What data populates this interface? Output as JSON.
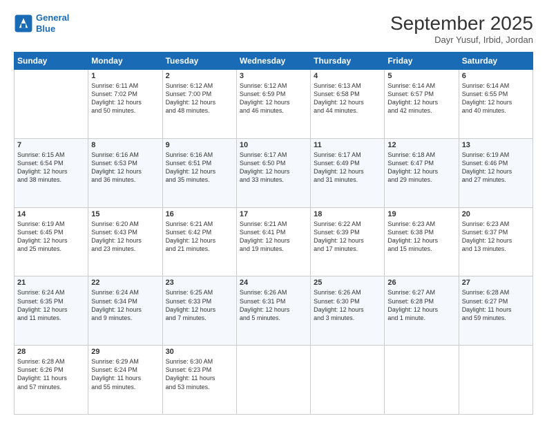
{
  "header": {
    "logo_line1": "General",
    "logo_line2": "Blue",
    "month": "September 2025",
    "location": "Dayr Yusuf, Irbid, Jordan"
  },
  "weekdays": [
    "Sunday",
    "Monday",
    "Tuesday",
    "Wednesday",
    "Thursday",
    "Friday",
    "Saturday"
  ],
  "weeks": [
    [
      {
        "day": "",
        "text": ""
      },
      {
        "day": "1",
        "text": "Sunrise: 6:11 AM\nSunset: 7:02 PM\nDaylight: 12 hours\nand 50 minutes."
      },
      {
        "day": "2",
        "text": "Sunrise: 6:12 AM\nSunset: 7:00 PM\nDaylight: 12 hours\nand 48 minutes."
      },
      {
        "day": "3",
        "text": "Sunrise: 6:12 AM\nSunset: 6:59 PM\nDaylight: 12 hours\nand 46 minutes."
      },
      {
        "day": "4",
        "text": "Sunrise: 6:13 AM\nSunset: 6:58 PM\nDaylight: 12 hours\nand 44 minutes."
      },
      {
        "day": "5",
        "text": "Sunrise: 6:14 AM\nSunset: 6:57 PM\nDaylight: 12 hours\nand 42 minutes."
      },
      {
        "day": "6",
        "text": "Sunrise: 6:14 AM\nSunset: 6:55 PM\nDaylight: 12 hours\nand 40 minutes."
      }
    ],
    [
      {
        "day": "7",
        "text": "Sunrise: 6:15 AM\nSunset: 6:54 PM\nDaylight: 12 hours\nand 38 minutes."
      },
      {
        "day": "8",
        "text": "Sunrise: 6:16 AM\nSunset: 6:53 PM\nDaylight: 12 hours\nand 36 minutes."
      },
      {
        "day": "9",
        "text": "Sunrise: 6:16 AM\nSunset: 6:51 PM\nDaylight: 12 hours\nand 35 minutes."
      },
      {
        "day": "10",
        "text": "Sunrise: 6:17 AM\nSunset: 6:50 PM\nDaylight: 12 hours\nand 33 minutes."
      },
      {
        "day": "11",
        "text": "Sunrise: 6:17 AM\nSunset: 6:49 PM\nDaylight: 12 hours\nand 31 minutes."
      },
      {
        "day": "12",
        "text": "Sunrise: 6:18 AM\nSunset: 6:47 PM\nDaylight: 12 hours\nand 29 minutes."
      },
      {
        "day": "13",
        "text": "Sunrise: 6:19 AM\nSunset: 6:46 PM\nDaylight: 12 hours\nand 27 minutes."
      }
    ],
    [
      {
        "day": "14",
        "text": "Sunrise: 6:19 AM\nSunset: 6:45 PM\nDaylight: 12 hours\nand 25 minutes."
      },
      {
        "day": "15",
        "text": "Sunrise: 6:20 AM\nSunset: 6:43 PM\nDaylight: 12 hours\nand 23 minutes."
      },
      {
        "day": "16",
        "text": "Sunrise: 6:21 AM\nSunset: 6:42 PM\nDaylight: 12 hours\nand 21 minutes."
      },
      {
        "day": "17",
        "text": "Sunrise: 6:21 AM\nSunset: 6:41 PM\nDaylight: 12 hours\nand 19 minutes."
      },
      {
        "day": "18",
        "text": "Sunrise: 6:22 AM\nSunset: 6:39 PM\nDaylight: 12 hours\nand 17 minutes."
      },
      {
        "day": "19",
        "text": "Sunrise: 6:23 AM\nSunset: 6:38 PM\nDaylight: 12 hours\nand 15 minutes."
      },
      {
        "day": "20",
        "text": "Sunrise: 6:23 AM\nSunset: 6:37 PM\nDaylight: 12 hours\nand 13 minutes."
      }
    ],
    [
      {
        "day": "21",
        "text": "Sunrise: 6:24 AM\nSunset: 6:35 PM\nDaylight: 12 hours\nand 11 minutes."
      },
      {
        "day": "22",
        "text": "Sunrise: 6:24 AM\nSunset: 6:34 PM\nDaylight: 12 hours\nand 9 minutes."
      },
      {
        "day": "23",
        "text": "Sunrise: 6:25 AM\nSunset: 6:33 PM\nDaylight: 12 hours\nand 7 minutes."
      },
      {
        "day": "24",
        "text": "Sunrise: 6:26 AM\nSunset: 6:31 PM\nDaylight: 12 hours\nand 5 minutes."
      },
      {
        "day": "25",
        "text": "Sunrise: 6:26 AM\nSunset: 6:30 PM\nDaylight: 12 hours\nand 3 minutes."
      },
      {
        "day": "26",
        "text": "Sunrise: 6:27 AM\nSunset: 6:28 PM\nDaylight: 12 hours\nand 1 minute."
      },
      {
        "day": "27",
        "text": "Sunrise: 6:28 AM\nSunset: 6:27 PM\nDaylight: 11 hours\nand 59 minutes."
      }
    ],
    [
      {
        "day": "28",
        "text": "Sunrise: 6:28 AM\nSunset: 6:26 PM\nDaylight: 11 hours\nand 57 minutes."
      },
      {
        "day": "29",
        "text": "Sunrise: 6:29 AM\nSunset: 6:24 PM\nDaylight: 11 hours\nand 55 minutes."
      },
      {
        "day": "30",
        "text": "Sunrise: 6:30 AM\nSunset: 6:23 PM\nDaylight: 11 hours\nand 53 minutes."
      },
      {
        "day": "",
        "text": ""
      },
      {
        "day": "",
        "text": ""
      },
      {
        "day": "",
        "text": ""
      },
      {
        "day": "",
        "text": ""
      }
    ]
  ]
}
